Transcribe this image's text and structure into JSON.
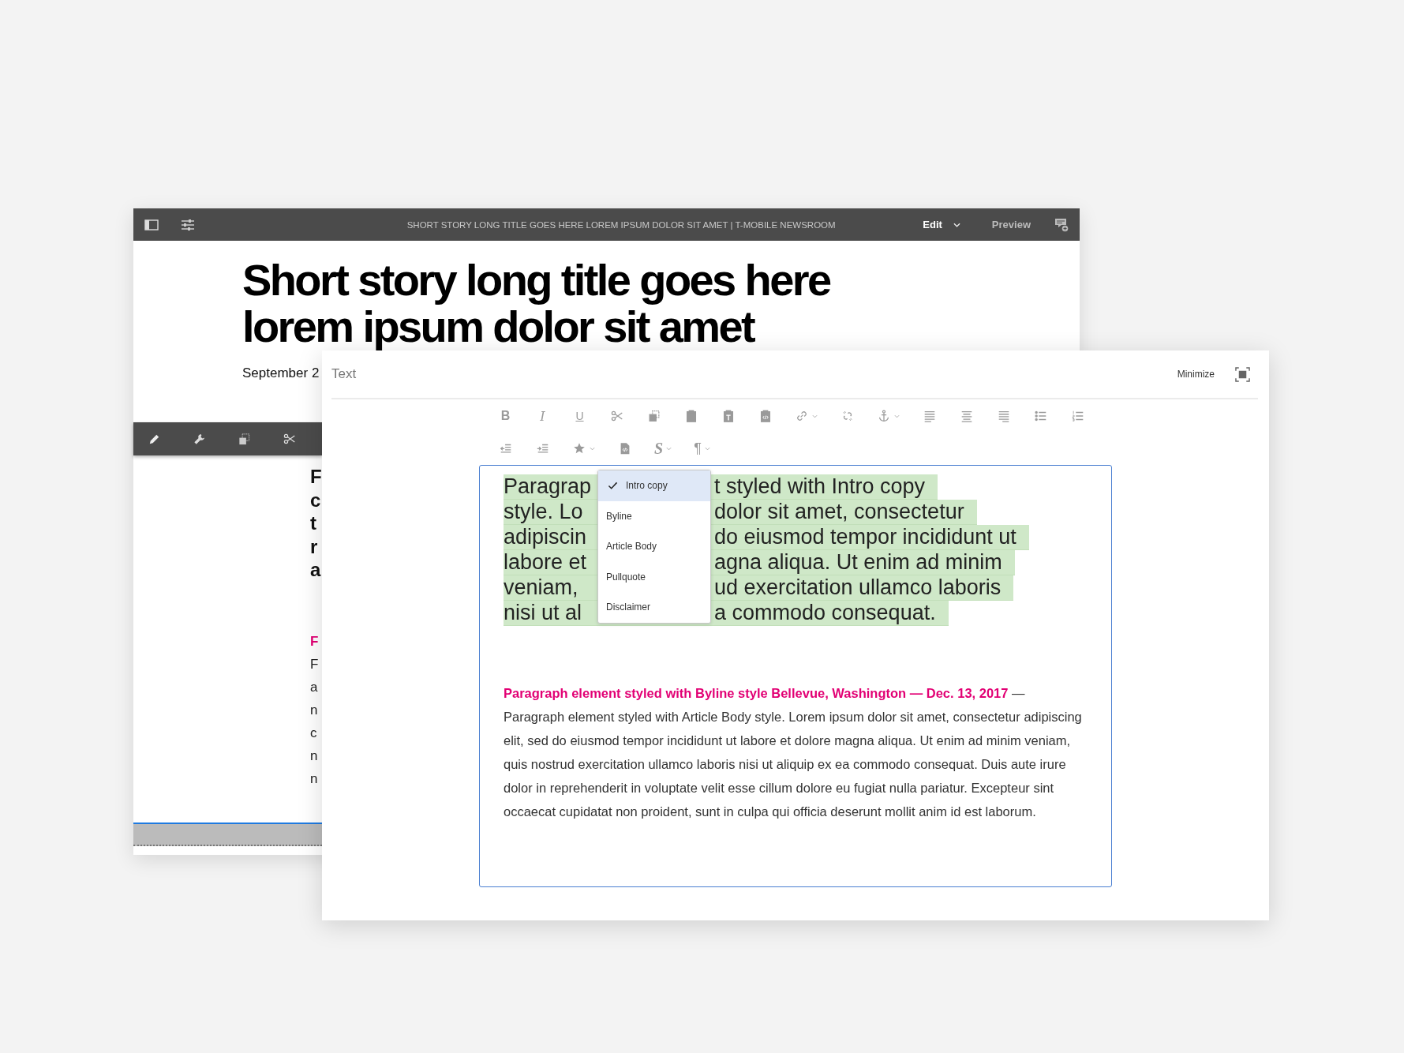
{
  "back_window": {
    "title": "SHORT STORY LONG TITLE GOES HERE LOREM IPSUM DOLOR SIT AMET | T-MOBILE NEWSROOM",
    "mode": "Edit",
    "preview": "Preview",
    "headline": [
      "Short story long title goes here",
      "lorem ipsum dolor sit amet"
    ],
    "date": "September 2",
    "column_fragments": [
      {
        "kind": "heading",
        "text": "F"
      },
      {
        "kind": "heading",
        "text": "c"
      },
      {
        "kind": "heading",
        "text": "t"
      },
      {
        "kind": "heading",
        "text": "r"
      },
      {
        "kind": "heading",
        "text": "a"
      },
      {
        "kind": "byline",
        "text": "F"
      },
      {
        "kind": "body",
        "text": "F"
      },
      {
        "kind": "body",
        "text": "a"
      },
      {
        "kind": "body",
        "text": "n"
      },
      {
        "kind": "body",
        "text": "c"
      },
      {
        "kind": "body",
        "text": "n"
      },
      {
        "kind": "body",
        "text": "n"
      }
    ]
  },
  "editor": {
    "title": "Text",
    "minimize": "Minimize",
    "toolbar": {
      "rows": [
        [
          {
            "kind": "glyph",
            "label": "B",
            "dropdown": false
          },
          {
            "kind": "glyph",
            "label": "I",
            "dropdown": false
          },
          {
            "kind": "glyph",
            "label": "U",
            "dropdown": false
          },
          {
            "kind": "icon",
            "dropdown": false
          },
          {
            "kind": "icon",
            "dropdown": false
          },
          {
            "kind": "icon",
            "dropdown": false
          },
          {
            "kind": "icon",
            "dropdown": false
          },
          {
            "kind": "icon",
            "dropdown": false
          },
          {
            "kind": "icon",
            "dropdown": true
          },
          {
            "kind": "icon",
            "dropdown": false
          },
          {
            "kind": "icon",
            "dropdown": true
          },
          {
            "kind": "icon",
            "dropdown": false
          },
          {
            "kind": "icon",
            "dropdown": false
          },
          {
            "kind": "icon",
            "dropdown": false
          },
          {
            "kind": "icon",
            "dropdown": false
          },
          {
            "kind": "icon",
            "dropdown": false
          }
        ],
        [
          {
            "kind": "icon",
            "dropdown": false
          },
          {
            "kind": "icon",
            "dropdown": false
          },
          {
            "kind": "icon",
            "dropdown": true
          },
          {
            "kind": "icon",
            "dropdown": false
          },
          {
            "kind": "glyph",
            "label": "S",
            "dropdown": true
          },
          {
            "kind": "glyph",
            "label": "¶",
            "dropdown": true
          }
        ]
      ]
    },
    "intro_lines": [
      {
        "left": "Paragrap",
        "right": "t styled with Intro copy"
      },
      {
        "left": "style. Lo",
        "right": "dolor sit amet, consectetur"
      },
      {
        "left": "adipiscin",
        "right": "do eiusmod tempor incididunt ut"
      },
      {
        "left": "labore et",
        "right": "agna aliqua. Ut enim ad minim"
      },
      {
        "left": "veniam,",
        "right": "ud exercitation ullamco laboris"
      },
      {
        "left": "nisi ut al",
        "right": "a commodo consequat."
      }
    ],
    "style_menu": [
      {
        "label": "Intro copy",
        "selected": true
      },
      {
        "label": "Byline",
        "selected": false
      },
      {
        "label": "Article Body",
        "selected": false
      },
      {
        "label": "Pullquote",
        "selected": false
      },
      {
        "label": "Disclaimer",
        "selected": false
      }
    ],
    "byline": "**Paragraph element styled with Byline style Bellevue, Washington — Dec. 13, 2017** —",
    "body": "Paragraph element styled with Article Body style. Lorem ipsum dolor sit amet, consectetur adipiscing elit, sed do eiusmod tempor incididunt ut labore et dolore magna aliqua. Ut enim ad minim veniam, quis nostrud exercitation ullamco laboris nisi ut aliquip ex ea commodo consequat. Duis aute irure dolor in reprehenderit in voluptate velit esse cillum dolore eu fugiat nulla pariatur. Excepteur sint occaecat cupidatat non proident, sunt in culpa qui officia deserunt mollit anim id est laborum."
  }
}
